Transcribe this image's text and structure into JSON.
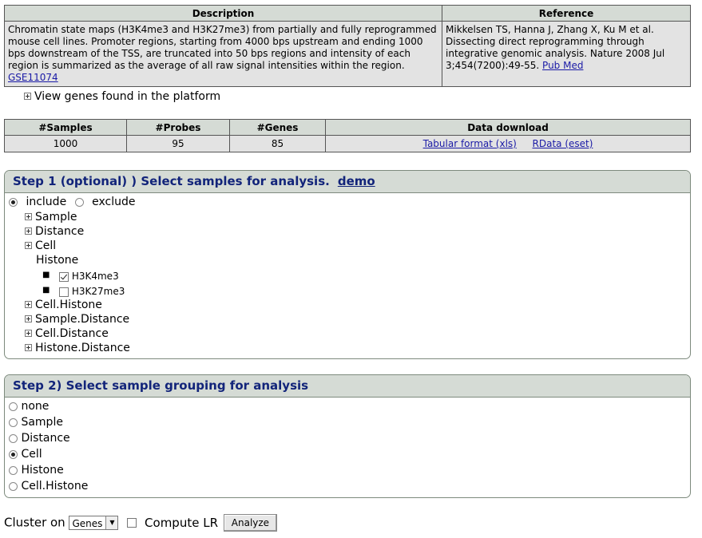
{
  "description_table": {
    "header_description": "Description",
    "header_reference": "Reference",
    "description_text": "Chromatin state maps (H3K4me3 and H3K27me3) from partially and fully reprogrammed mouse cell lines. Promoter regions, starting from 4000 bps upstream and ending 1000 bps downstream of the TSS, are truncated into 50 bps regions and intensity of each region is summarized as the average of all raw signal intensities within the region.",
    "description_link": "GSE11074",
    "reference_text": "Mikkelsen TS, Hanna J, Zhang X, Ku M et al. Dissecting direct reprogramming through integrative genomic analysis. Nature 2008 Jul 3;454(7200):49-55.",
    "reference_link": "Pub Med"
  },
  "view_genes_label": "View genes found in the platform",
  "stats_table": {
    "headers": [
      "#Samples",
      "#Probes",
      "#Genes",
      "Data download"
    ],
    "samples": "1000",
    "probes": "95",
    "genes": "85",
    "download_xls": "Tabular format (xls)",
    "download_rdata": "RData (eset)"
  },
  "step1": {
    "title": "Step 1 (optional) ) Select samples for analysis.",
    "demo_link": "demo",
    "include_label": "include",
    "exclude_label": "exclude",
    "include_selected": true,
    "tree": {
      "sample": "Sample",
      "distance": "Distance",
      "cell": "Cell",
      "histone": "Histone",
      "histone_options": [
        {
          "label": "H3K4me3",
          "checked": true
        },
        {
          "label": "H3K27me3",
          "checked": false
        }
      ],
      "cell_histone": "Cell.Histone",
      "sample_distance": "Sample.Distance",
      "cell_distance": "Cell.Distance",
      "histone_distance": "Histone.Distance"
    }
  },
  "step2": {
    "title": "Step 2) Select sample grouping for analysis",
    "options": [
      {
        "label": "none",
        "selected": false
      },
      {
        "label": "Sample",
        "selected": false
      },
      {
        "label": "Distance",
        "selected": false
      },
      {
        "label": "Cell",
        "selected": true
      },
      {
        "label": "Histone",
        "selected": false
      },
      {
        "label": "Cell.Histone",
        "selected": false
      }
    ]
  },
  "bottom": {
    "cluster_label": "Cluster on",
    "cluster_value": "Genes",
    "compute_lr_label": "Compute LR",
    "analyze_label": "Analyze"
  },
  "icons": {
    "expander": "plus-box-icon",
    "dropdown": "chevron-down-icon"
  },
  "colors": {
    "header_bg": "#d5dbd5",
    "panel_title": "#12247a",
    "cell_bg": "#e3e3e3",
    "link": "#1a1aa6"
  }
}
